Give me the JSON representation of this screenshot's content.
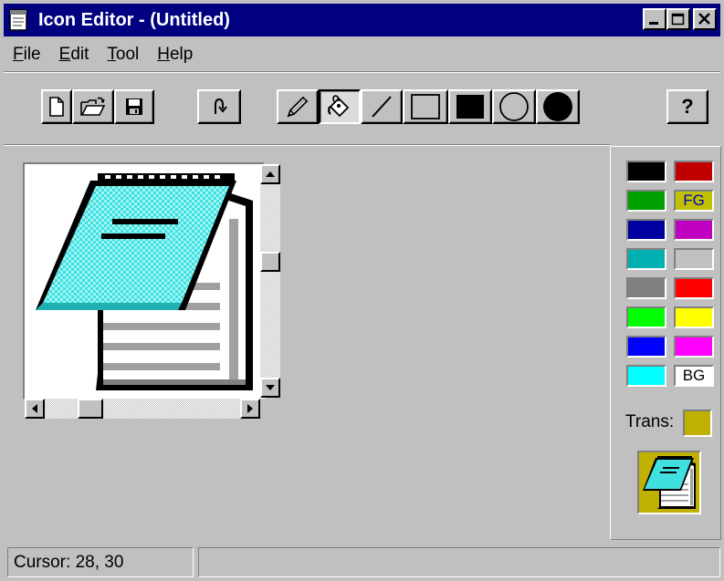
{
  "window": {
    "title": "Icon Editor - (Untitled)",
    "title_bar_color": "#000080",
    "buttons": [
      "minimize-icon",
      "maximize-icon",
      "close-icon"
    ]
  },
  "menu": {
    "items": [
      {
        "label": "File",
        "accel": "F",
        "rest": "ile"
      },
      {
        "label": "Edit",
        "accel": "E",
        "rest": "dit"
      },
      {
        "label": "Tool",
        "accel": "T",
        "rest": "ool"
      },
      {
        "label": "Help",
        "accel": "H",
        "rest": "elp"
      }
    ]
  },
  "toolbar": {
    "file_buttons": [
      "new-file-icon",
      "open-folder-icon",
      "save-disk-icon"
    ],
    "undo_button": "undo-icon",
    "tools": [
      "pencil-icon",
      "fill-bucket-icon",
      "line-icon",
      "rectangle-outline-icon",
      "rectangle-filled-icon",
      "ellipse-outline-icon",
      "ellipse-filled-icon"
    ],
    "active_tool": "fill-bucket-icon",
    "help_label": "?"
  },
  "palette": {
    "colors": [
      {
        "color": "#000000",
        "label": ""
      },
      {
        "color": "#c00000",
        "label": ""
      },
      {
        "color": "#00a000",
        "label": ""
      },
      {
        "color": "#c0c000",
        "label": "FG",
        "label_color": "#0000c0"
      },
      {
        "color": "#0000a0",
        "label": ""
      },
      {
        "color": "#c000c0",
        "label": ""
      },
      {
        "color": "#00b0b0",
        "label": ""
      },
      {
        "color": "#c0c0c0",
        "label": ""
      },
      {
        "color": "#808080",
        "label": ""
      },
      {
        "color": "#ff0000",
        "label": ""
      },
      {
        "color": "#00ff00",
        "label": ""
      },
      {
        "color": "#ffff00",
        "label": ""
      },
      {
        "color": "#0000ff",
        "label": ""
      },
      {
        "color": "#ff00ff",
        "label": ""
      },
      {
        "color": "#00ffff",
        "label": ""
      },
      {
        "color": "#ffffff",
        "label": "BG",
        "label_color": "#000000"
      }
    ],
    "trans_label": "Trans:",
    "trans_color": "#c0b000"
  },
  "icon_colors": {
    "cyan": "#40e0e0",
    "cyan_light": "#90f0f0",
    "outline": "#000000",
    "page_shade": "#a0a0a0"
  },
  "status": {
    "cursor_text": "Cursor: 28, 30"
  }
}
